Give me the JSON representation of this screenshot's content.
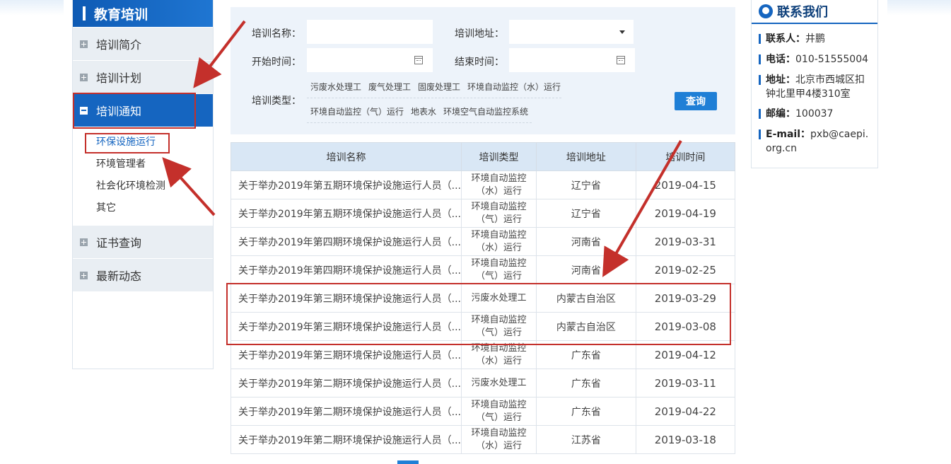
{
  "sidebar": {
    "header": "教育培训",
    "items": [
      {
        "label": "培训简介"
      },
      {
        "label": "培训计划"
      },
      {
        "label": "培训通知"
      },
      {
        "label": "证书查询"
      },
      {
        "label": "最新动态"
      }
    ],
    "sub_items": [
      {
        "label": "环保设施运行"
      },
      {
        "label": "环境管理者"
      },
      {
        "label": "社会化环境检测"
      },
      {
        "label": "其它"
      }
    ]
  },
  "search": {
    "name_label": "培训名称：",
    "address_label": "培训地址：",
    "start_label": "开始时间：",
    "end_label": "结束时间：",
    "type_label": "培训类型：",
    "types": [
      "污废水处理工",
      "废气处理工",
      "固废处理工",
      "环境自动监控（水）运行",
      "环境自动监控（气）运行",
      "地表水",
      "环境空气自动监控系统"
    ],
    "query_button": "查询"
  },
  "table": {
    "headers": [
      "培训名称",
      "培训类型",
      "培训地址",
      "培训时间"
    ],
    "rows": [
      {
        "name": "关于举办2019年第五期环境保护设施运行人员（...",
        "type": "环境自动监控（水）运行",
        "address": "辽宁省",
        "date": "2019-04-15"
      },
      {
        "name": "关于举办2019年第五期环境保护设施运行人员（...",
        "type": "环境自动监控（气）运行",
        "address": "辽宁省",
        "date": "2019-04-19"
      },
      {
        "name": "关于举办2019年第四期环境保护设施运行人员（...",
        "type": "环境自动监控（水）运行",
        "address": "河南省",
        "date": "2019-03-31"
      },
      {
        "name": "关于举办2019年第四期环境保护设施运行人员（...",
        "type": "环境自动监控（气）运行",
        "address": "河南省",
        "date": "2019-02-25"
      },
      {
        "name": "关于举办2019年第三期环境保护设施运行人员（...",
        "type": "污废水处理工",
        "address": "内蒙古自治区",
        "date": "2019-03-29"
      },
      {
        "name": "关于举办2019年第三期环境保护设施运行人员（...",
        "type": "环境自动监控（气）运行",
        "address": "内蒙古自治区",
        "date": "2019-03-08"
      },
      {
        "name": "关于举办2019年第三期环境保护设施运行人员（...",
        "type": "环境自动监控（水）运行",
        "address": "广东省",
        "date": "2019-04-12"
      },
      {
        "name": "关于举办2019年第二期环境保护设施运行人员（...",
        "type": "污废水处理工",
        "address": "广东省",
        "date": "2019-03-11"
      },
      {
        "name": "关于举办2019年第二期环境保护设施运行人员（...",
        "type": "环境自动监控（气）运行",
        "address": "广东省",
        "date": "2019-04-22"
      },
      {
        "name": "关于举办2019年第二期环境保护设施运行人员（...",
        "type": "环境自动监控（水）运行",
        "address": "江苏省",
        "date": "2019-03-18"
      }
    ]
  },
  "contact": {
    "title": "联系我们",
    "person_label": "联系人：",
    "person": "井鹏",
    "phone_label": "电话：",
    "phone": "010-51555004",
    "address_label": "地址：",
    "address": "北京市西城区扣钟北里甲4楼310室",
    "zip_label": "邮编：",
    "zip": "100037",
    "email_label": "E-mail：",
    "email": "pxb@caepi.org.cn"
  },
  "colors": {
    "accent": "#1565c0",
    "annotation": "#c4302b",
    "panel": "#edf3fa"
  }
}
